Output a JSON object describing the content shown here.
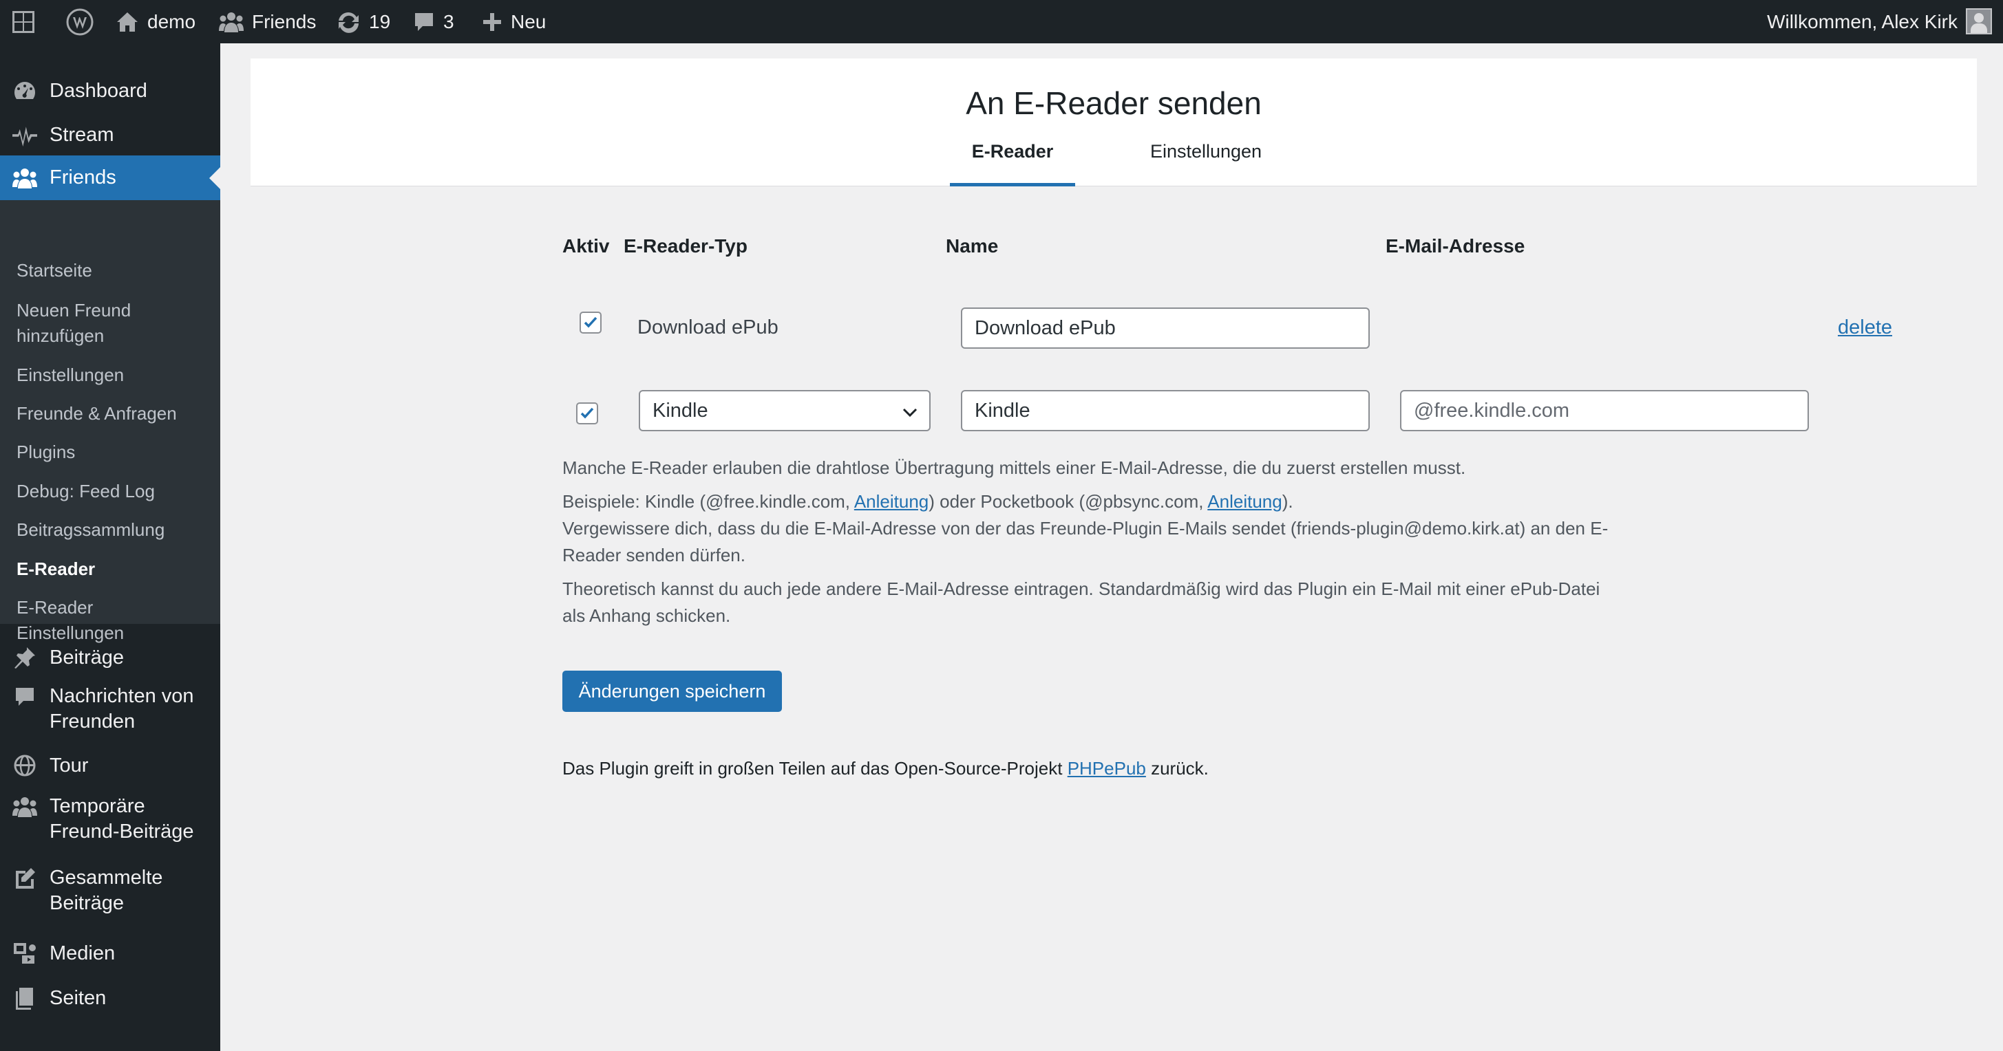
{
  "adminbar": {
    "site_name": "demo",
    "friends_label": "Friends",
    "updates_count": "19",
    "comments_count": "3",
    "new_label": "Neu",
    "greeting": "Willkommen, Alex Kirk"
  },
  "sidebar": {
    "top_items": [
      {
        "label": "Dashboard",
        "icon": "dashboard-icon"
      },
      {
        "label": "Stream",
        "icon": "stream-icon"
      },
      {
        "label": "Friends",
        "icon": "friends-icon",
        "current": true
      }
    ],
    "submenu": [
      {
        "label": "Startseite"
      },
      {
        "label": "Neuen Freund hinzufügen"
      },
      {
        "label": "Einstellungen"
      },
      {
        "label": "Freunde & Anfragen"
      },
      {
        "label": "Plugins"
      },
      {
        "label": "Debug: Feed Log"
      },
      {
        "label": "Beitragssammlung"
      },
      {
        "label": "E-Reader",
        "current": true
      },
      {
        "label": "E-Reader Einstellungen"
      }
    ],
    "bottom_items": [
      {
        "label": "Beiträge",
        "icon": "pushpin-icon"
      },
      {
        "label": "Nachrichten von Freunden",
        "icon": "comment-icon"
      },
      {
        "label": "Tour",
        "icon": "globe-icon"
      },
      {
        "label": "Temporäre Freund-Beiträge",
        "icon": "friends-icon"
      },
      {
        "label": "Gesammelte Beiträge",
        "icon": "edit-page-icon"
      },
      {
        "label": "Medien",
        "icon": "media-icon"
      },
      {
        "label": "Seiten",
        "icon": "page-icon"
      }
    ]
  },
  "header": {
    "title": "An E-Reader senden",
    "tabs": [
      {
        "label": "E-Reader",
        "active": true
      },
      {
        "label": "Einstellungen",
        "active": false
      }
    ]
  },
  "table": {
    "columns": {
      "active": "Aktiv",
      "type": "E-Reader-Typ",
      "name": "Name",
      "email": "E-Mail-Adresse"
    },
    "rows": [
      {
        "checked": true,
        "type": "Download ePub",
        "name": "Download ePub",
        "delete_label": "delete"
      },
      {
        "checked": true,
        "type": "Kindle",
        "name": "Kindle",
        "email_placeholder": "@free.kindle.com"
      }
    ]
  },
  "help": {
    "line1": "Manche E-Reader erlauben die drahtlose Übertragung mittels einer E-Mail-Adresse, die du zuerst erstellen musst.",
    "examples_prefix": "Beispiele: Kindle (@free.kindle.com, ",
    "link_anleitung_1": "Anleitung",
    "examples_middle": ") oder Pocketbook (@pbsync.com, ",
    "link_anleitung_2": "Anleitung",
    "examples_suffix": ").",
    "verify_line1": "Vergewissere dich, dass du die E-Mail-Adresse von der das Freunde-Plugin E-Mails sendet (friends-plugin@demo.kirk.at) an den E-",
    "verify_line2": "Reader senden dürfen.",
    "theory_line1": "Theoretisch kannst du auch jede andere E-Mail-Adresse eintragen. Standardmäßig wird das Plugin ein E-Mail mit einer ePub-Datei",
    "theory_line2": "als Anhang schicken."
  },
  "save_button": "Änderungen speichern",
  "footer": {
    "prefix": "Das Plugin greift in großen Teilen auf das Open-Source-Projekt ",
    "link": "PHPePub",
    "suffix": " zurück."
  },
  "colors": {
    "adminbar_bg": "#1d2327",
    "accent": "#2271b1",
    "page_bg": "#f0f0f1"
  }
}
